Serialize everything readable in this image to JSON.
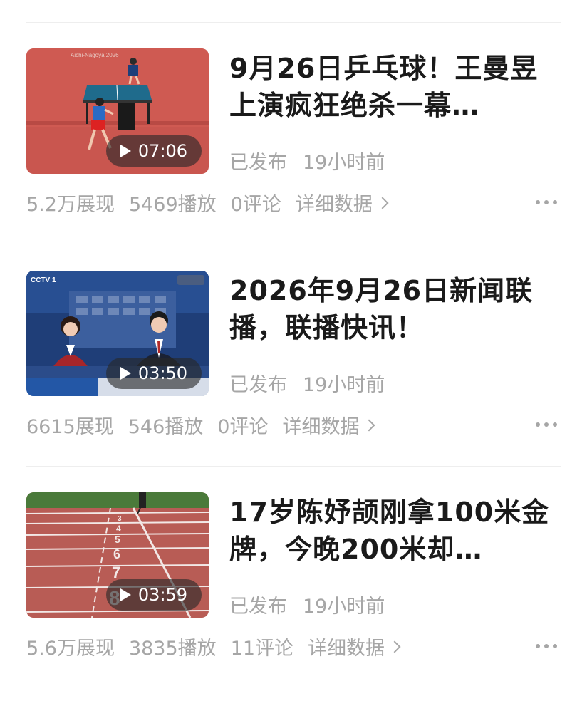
{
  "videos": [
    {
      "title": "9月26日乒乓球！王曼昱上演疯狂绝杀一幕…",
      "duration": "07:06",
      "published_label": "已发布",
      "published_time": "19小时前",
      "impressions": "5.2万展现",
      "plays": "5469播放",
      "comments": "0评论",
      "detail": "详细数据",
      "thumb_text": "Aichi-Nagoya 2026",
      "thumb_kind": "table-tennis"
    },
    {
      "title": "2026年9月26日新闻联播，联播快讯！",
      "duration": "03:50",
      "published_label": "已发布",
      "published_time": "19小时前",
      "impressions": "6615展现",
      "plays": "546播放",
      "comments": "0评论",
      "detail": "详细数据",
      "thumb_text": "CCTV 1",
      "thumb_kind": "news"
    },
    {
      "title": "17岁陈妤颉刚拿100米金牌，今晚200米却…",
      "duration": "03:59",
      "published_label": "已发布",
      "published_time": "19小时前",
      "impressions": "5.6万展现",
      "plays": "3835播放",
      "comments": "11评论",
      "detail": "详细数据",
      "thumb_text": "",
      "thumb_kind": "track"
    }
  ],
  "colors": {
    "title": "#1a1a1a",
    "meta": "#a6a6a6",
    "divider": "#eeeeee"
  }
}
